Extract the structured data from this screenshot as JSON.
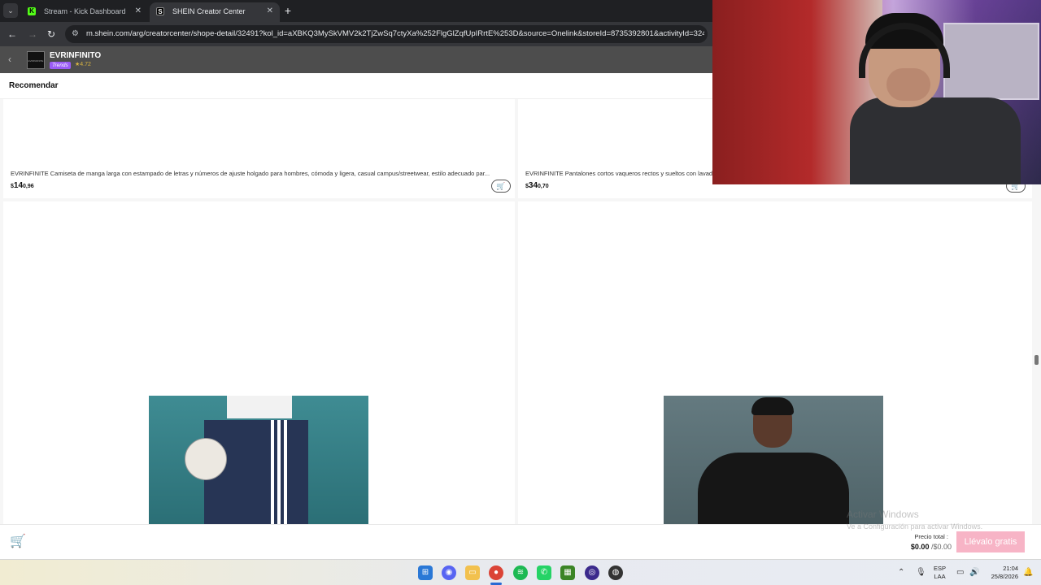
{
  "browser": {
    "tabs": [
      {
        "label": "Stream - Kick Dashboard",
        "favicon": "K",
        "active": false
      },
      {
        "label": "SHEIN Creator Center",
        "favicon": "S",
        "active": true
      }
    ],
    "new_tab_label": "+",
    "url": "m.shein.com/arg/creatorcenter/shope-detail/32491?kol_id=aXBKQ3MySkVMV2k2TjZwSq7ctyXa%252FlgGlZqfUpIRrtE%253D&source=Onelink&storeId=8735392801&activityId=32491"
  },
  "store": {
    "name": "EVRINFINITO",
    "badge": "Trends",
    "rating": "★4.72",
    "logo_text": "EVRINFINITE"
  },
  "tabs": {
    "recommend": "Recomendar"
  },
  "products": [
    {
      "title": "EVRINFINITE Camiseta de manga larga con estampado de letras y números de ajuste holgado para hombres, cómoda y ligera, casual campus/streetwear, estilo adecuado par...",
      "price_currency": "$",
      "price_int": "14",
      "price_cents": "0,96"
    },
    {
      "title": "EVRINFINITE Pantalones cortos vaqueros rectos y sueltos con lavad",
      "price_currency": "$",
      "price_int": "34",
      "price_cents": "0,70"
    }
  ],
  "checkout": {
    "total_label": "Precio total :",
    "total_value": "$0.00",
    "total_original": "/$0.00",
    "cta": "Llévalo gratis"
  },
  "watermark": {
    "line1": "Activar Windows",
    "line2": "Ve a Configuración para activar Windows."
  },
  "taskbar": {
    "lang": "ESP",
    "lang_sub": "LAA",
    "time": "21:04",
    "date": "25/8/2026"
  }
}
